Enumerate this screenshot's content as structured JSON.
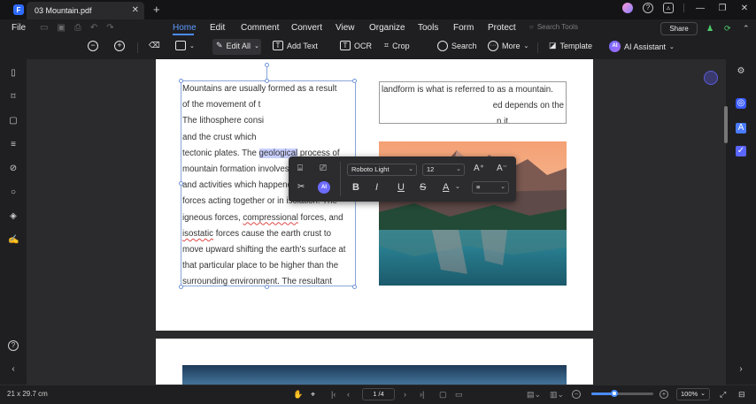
{
  "titlebar": {
    "tab_title": "03 Mountain.pdf",
    "tab_close": "✕",
    "new_tab": "+",
    "window_buttons": [
      "—",
      "❐",
      "✕"
    ]
  },
  "menubar": {
    "file_label": "File",
    "items": [
      "Home",
      "Edit",
      "Comment",
      "Convert",
      "View",
      "Organize",
      "Tools",
      "Form",
      "Protect"
    ],
    "active_item": "Home",
    "search_placeholder": "Search Tools",
    "share_label": "Share"
  },
  "toolbar": {
    "edit_all_label": "Edit All",
    "add_text_label": "Add Text",
    "ocr_label": "OCR",
    "crop_label": "Crop",
    "search_label": "Search",
    "more_label": "More",
    "template_label": "Template",
    "ai_assistant_label": "AI Assistant"
  },
  "format_toolbar": {
    "font_family": "Roboto Light",
    "font_size": "12",
    "ai_label": "AI",
    "bold": "B",
    "italic": "I",
    "underline": "U",
    "strike": "S",
    "font_color": "A"
  },
  "document": {
    "left_lines": [
      "Mountains are usually formed as a result",
      "of the movement of t",
      "The lithosphere consi",
      "and the crust which",
      "tectonic plates. The ",
      "mountain formation involves many process",
      "and activities which happened due to many",
      "forces acting together or in isolation. The",
      "igneous forces, ",
      "isostatic",
      "move upward shifting the earth's surface at",
      "that particular place to be higher than the",
      "surrounding environment. The resultant"
    ],
    "highlighted_word": "geological",
    "line5_tail": " process of",
    "wavy_word_1": "compressional",
    "line9_tail": " forces, and",
    "line10_tail": " forces cause the earth crust to",
    "right_lines": [
      "landform is what is referred to as a mountain.",
      "ed depends on the",
      "n it."
    ]
  },
  "statusbar": {
    "page_size": "21 x 29.7 cm",
    "page_indicator": "1 /4",
    "zoom_level": "100%",
    "zoom_fraction": 0.37
  },
  "colors": {
    "accent": "#4a8cff",
    "highlight": "#c9cfff",
    "page_bg": "#ffffff",
    "app_bg": "#1f1f21"
  }
}
